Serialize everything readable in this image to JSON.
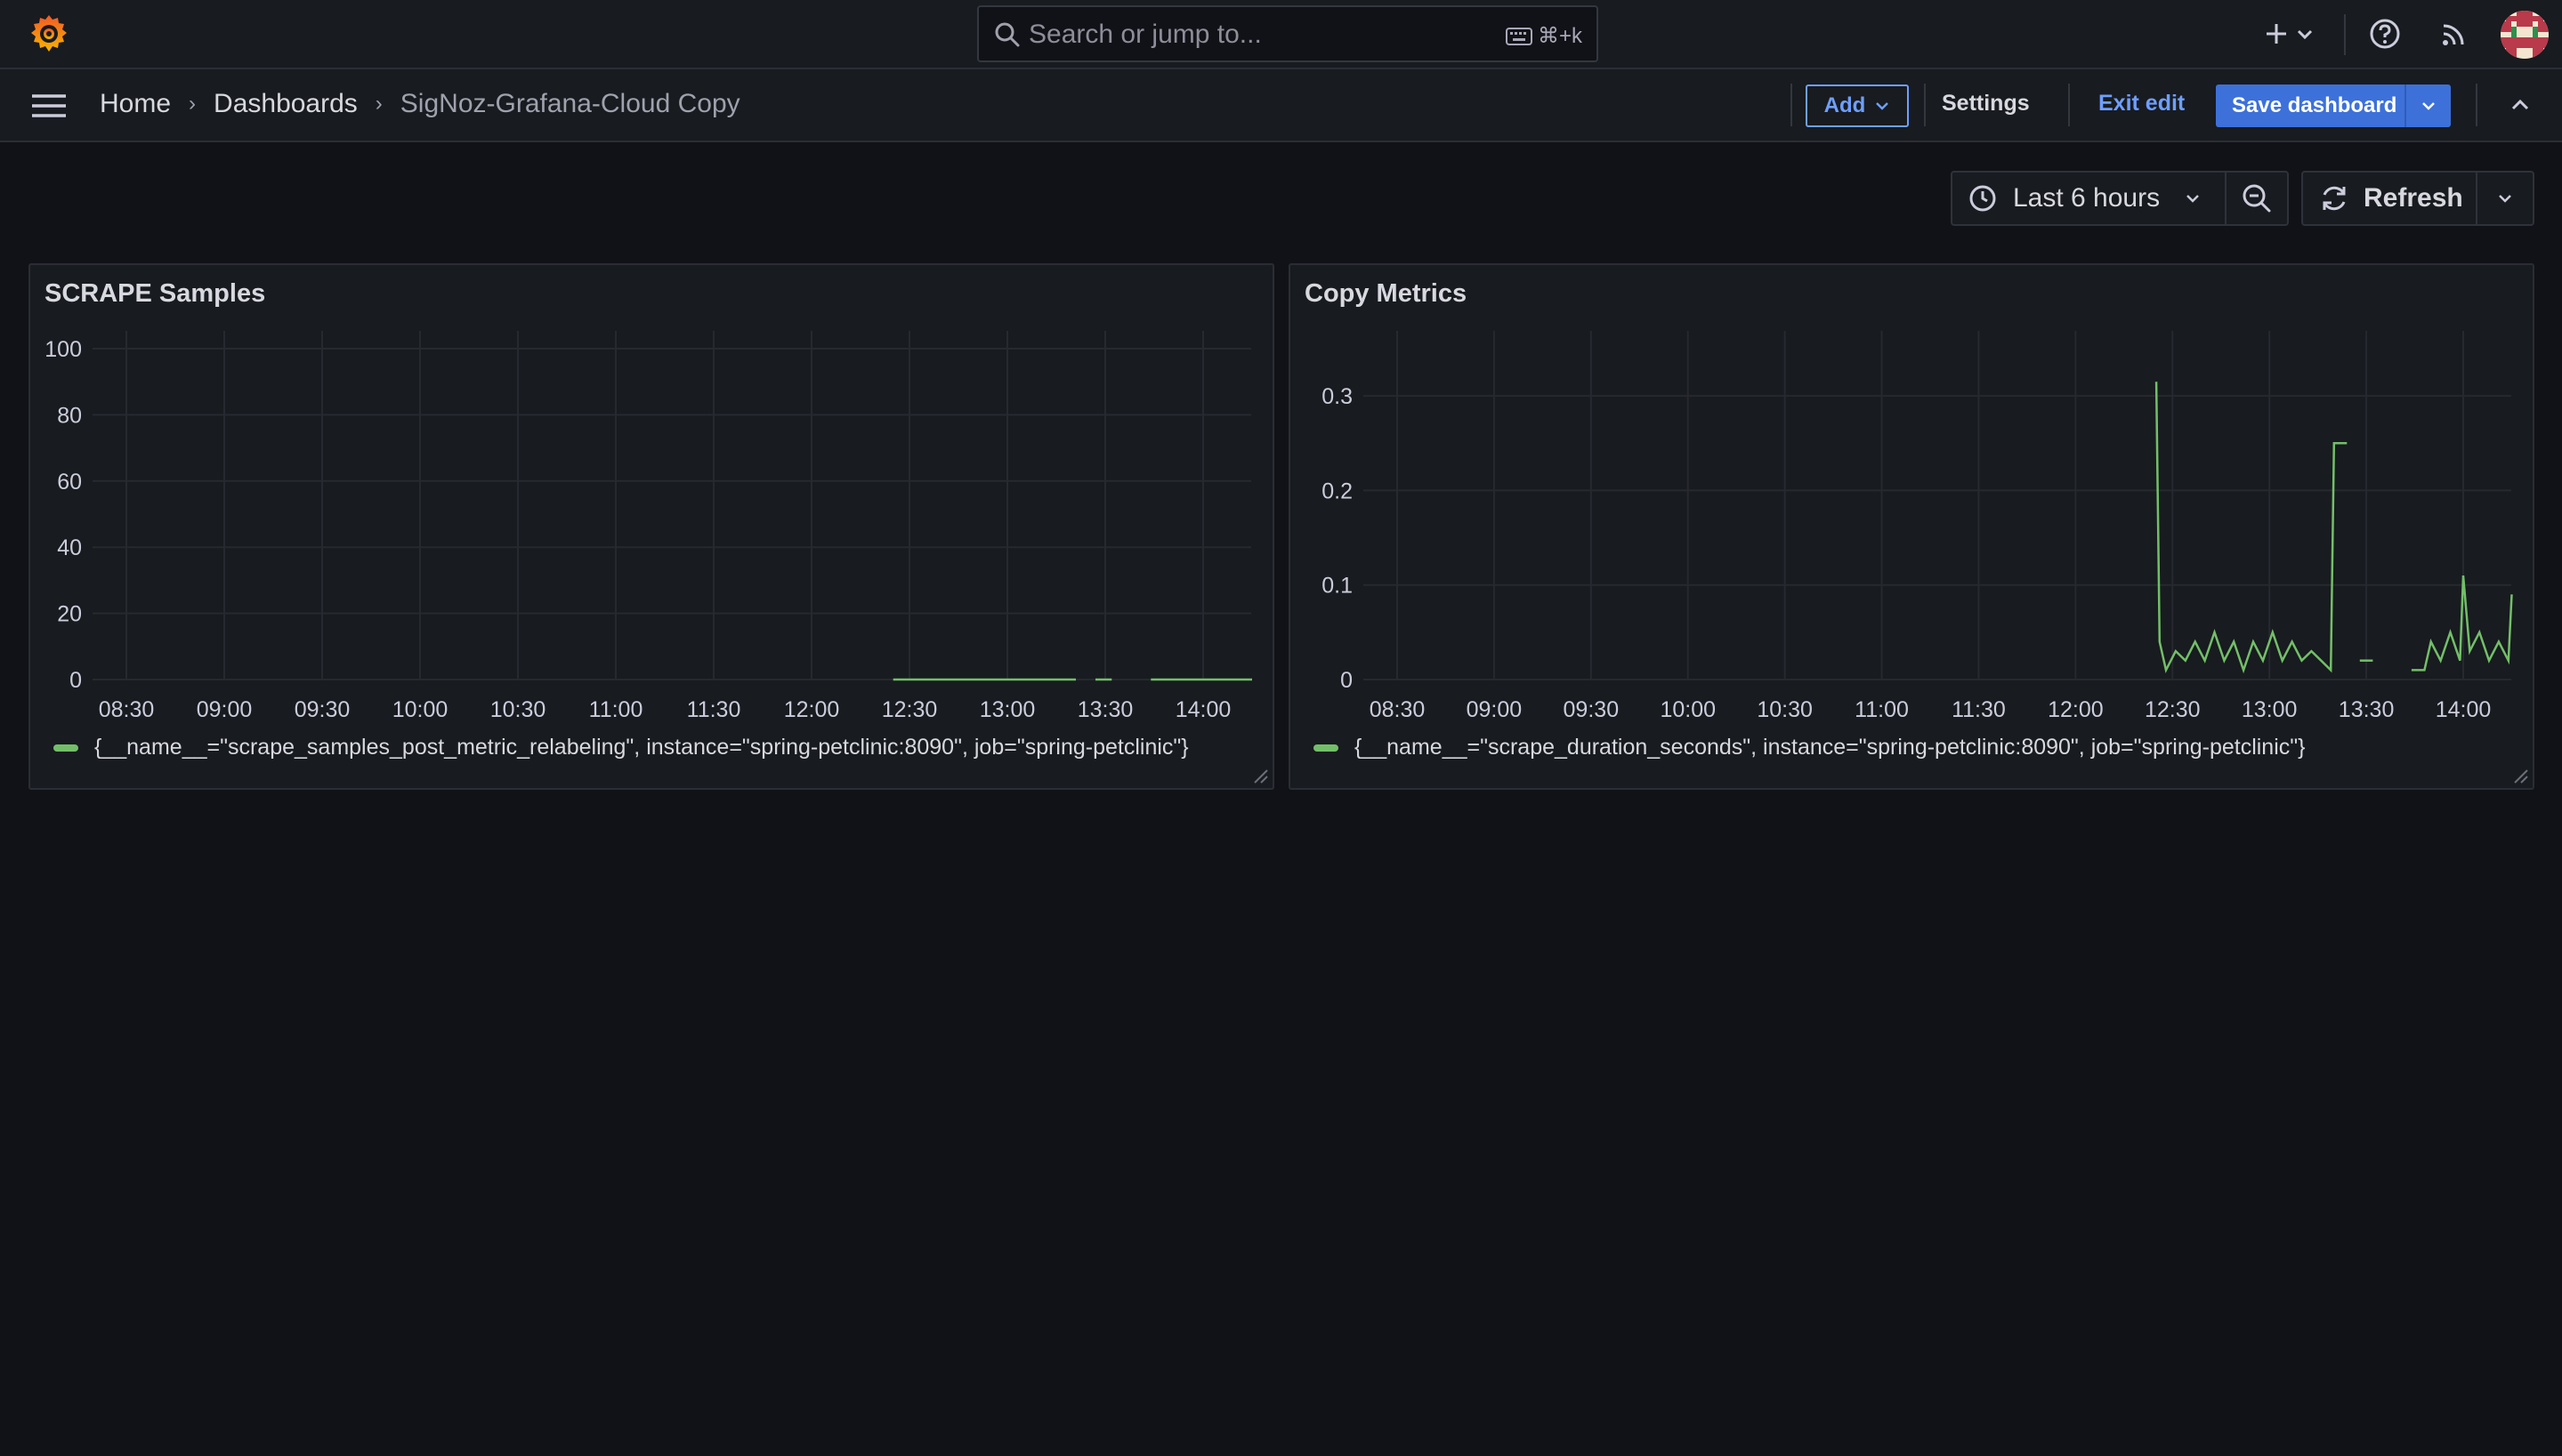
{
  "topbar": {
    "search_placeholder": "Search or jump to...",
    "search_shortcut": "⌘+k",
    "icons": [
      "grafana-logo-icon",
      "plus-icon",
      "chevron-down-icon",
      "help-icon",
      "news-feed-icon",
      "avatar"
    ]
  },
  "navbar": {
    "breadcrumbs": [
      "Home",
      "Dashboards",
      "SigNoz-Grafana-Cloud Copy"
    ],
    "add_label": "Add",
    "settings_label": "Settings",
    "exit_edit_label": "Exit edit",
    "save_label": "Save dashboard"
  },
  "time_controls": {
    "range_label": "Last 6 hours",
    "refresh_label": "Refresh"
  },
  "colors": {
    "background": "#111217",
    "panel": "#181b1f",
    "accent": "#6e9fff",
    "primary_button": "#3d71d9",
    "series": "#73bf69"
  },
  "chart_data": [
    {
      "type": "line",
      "title": "SCRAPE Samples",
      "x_ticks": [
        "08:30",
        "09:00",
        "09:30",
        "10:00",
        "10:30",
        "11:00",
        "11:30",
        "12:00",
        "12:30",
        "13:00",
        "13:30",
        "14:00"
      ],
      "y_ticks": [
        "0",
        "20",
        "40",
        "60",
        "80",
        "100"
      ],
      "ylim": [
        0,
        100
      ],
      "grid": true,
      "legend_placement": "bottom-left",
      "series": [
        {
          "name": "{__name__=\"scrape_samples_post_metric_relabeling\", instance=\"spring-petclinic:8090\", job=\"spring-petclinic\"}",
          "color": "#73bf69",
          "segments": [
            [
              [
                "12:25",
                0
              ],
              [
                "13:21",
                0
              ]
            ],
            [
              [
                "13:27",
                0
              ],
              [
                "13:32",
                0
              ]
            ],
            [
              [
                "13:44",
                0
              ],
              [
                "14:15",
                0
              ]
            ]
          ]
        }
      ]
    },
    {
      "type": "line",
      "title": "Copy Metrics",
      "x_ticks": [
        "08:30",
        "09:00",
        "09:30",
        "10:00",
        "10:30",
        "11:00",
        "11:30",
        "12:00",
        "12:30",
        "13:00",
        "13:30",
        "14:00"
      ],
      "y_ticks": [
        "0",
        "0.1",
        "0.2",
        "0.3"
      ],
      "ylim": [
        0,
        0.35
      ],
      "grid": true,
      "legend_placement": "bottom-left",
      "series": [
        {
          "name": "{__name__=\"scrape_duration_seconds\", instance=\"spring-petclinic:8090\", job=\"spring-petclinic\"}",
          "color": "#73bf69",
          "segments": [
            [
              [
                "12:25",
                0.315
              ],
              [
                "12:26",
                0.04
              ],
              [
                "12:28",
                0.01
              ],
              [
                "12:31",
                0.03
              ],
              [
                "12:34",
                0.02
              ],
              [
                "12:37",
                0.04
              ],
              [
                "12:40",
                0.02
              ],
              [
                "12:43",
                0.05
              ],
              [
                "12:46",
                0.02
              ],
              [
                "12:49",
                0.04
              ],
              [
                "12:52",
                0.01
              ],
              [
                "12:55",
                0.04
              ],
              [
                "12:58",
                0.02
              ],
              [
                "13:01",
                0.05
              ],
              [
                "13:04",
                0.02
              ],
              [
                "13:07",
                0.04
              ],
              [
                "13:10",
                0.02
              ],
              [
                "13:13",
                0.03
              ],
              [
                "13:16",
                0.02
              ],
              [
                "13:19",
                0.01
              ],
              [
                "13:20",
                0.25
              ],
              [
                "13:24",
                0.25
              ]
            ],
            [
              [
                "13:28",
                0.02
              ],
              [
                "13:32",
                0.02
              ]
            ],
            [
              [
                "13:44",
                0.01
              ],
              [
                "13:48",
                0.01
              ],
              [
                "13:50",
                0.04
              ],
              [
                "13:53",
                0.02
              ],
              [
                "13:56",
                0.05
              ],
              [
                "13:59",
                0.02
              ],
              [
                "14:00",
                0.11
              ],
              [
                "14:02",
                0.03
              ],
              [
                "14:05",
                0.05
              ],
              [
                "14:08",
                0.02
              ],
              [
                "14:11",
                0.04
              ],
              [
                "14:14",
                0.02
              ],
              [
                "14:15",
                0.09
              ]
            ]
          ]
        }
      ]
    }
  ]
}
